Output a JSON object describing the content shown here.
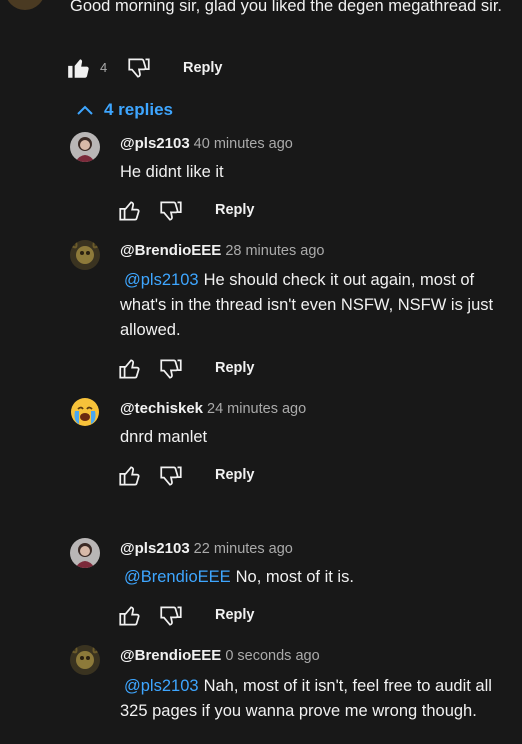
{
  "top_comment": {
    "text": "Good morning sir, glad you liked the degen megathread sir.",
    "like_count": "4",
    "reply_label": "Reply"
  },
  "replies_toggle": {
    "label": "4 replies"
  },
  "replies": [
    {
      "author": "@pls2103",
      "time": "40 minutes ago",
      "mention": "",
      "text": "He didnt like it",
      "reply_label": "Reply"
    },
    {
      "author": "@BrendioEEE",
      "time": "28 minutes ago",
      "mention": "@pls2103",
      "text": "He should check it out again, most of what's in the thread isn't even NSFW, NSFW is just allowed.",
      "reply_label": "Reply"
    },
    {
      "author": "@techiskek",
      "time": "24 minutes ago",
      "mention": "",
      "text": "dnrd manlet",
      "reply_label": "Reply"
    },
    {
      "author": "@pls2103",
      "time": "22 minutes ago",
      "mention": "@BrendioEEE",
      "text": "No, most of it is.",
      "reply_label": "Reply"
    },
    {
      "author": "@BrendioEEE",
      "time": "0 seconds ago",
      "mention": "@pls2103",
      "text": "Nah, most of it isn't, feel free to audit all 325 pages if you wanna prove me wrong though."
    }
  ],
  "colors": {
    "background": "#181818",
    "link": "#3ea6ff",
    "muted": "#aaaaaa"
  }
}
